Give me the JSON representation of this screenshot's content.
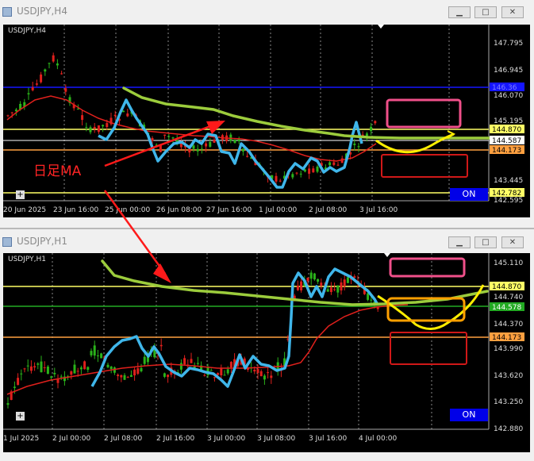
{
  "chart_data": [
    {
      "type": "candlestick",
      "window_title": "USDJPY,H4",
      "symbol_label": "USDJPY,H4",
      "y_ticks": [
        "147.795",
        "146.945",
        "146.070",
        "145.195",
        "144.870",
        "144.587",
        "144.173",
        "143.445",
        "142.782",
        "142.595"
      ],
      "x_ticks": [
        "20 Jun 2025",
        "23 Jun 16:00",
        "25 Jun 00:00",
        "26 Jun 08:00",
        "27 Jun 16:00",
        "1 Jul 00:00",
        "2 Jul 08:00",
        "3 Jul 16:00"
      ],
      "hidden_label": "146.36",
      "price_lines": [
        {
          "value": 146.36,
          "color": "#1515ff"
        },
        {
          "value": 144.87,
          "color": "#ffff66"
        },
        {
          "value": 144.587,
          "color": "#ffffff"
        },
        {
          "value": 144.173,
          "color": "#ffa040"
        },
        {
          "value": 142.782,
          "color": "#ffff66"
        }
      ],
      "annotation_text": "日足MA",
      "on_label": "ON"
    },
    {
      "type": "candlestick",
      "window_title": "USDJPY,H1",
      "symbol_label": "USDJPY,H1",
      "y_ticks": [
        "145.110",
        "144.870",
        "144.740",
        "144.578",
        "144.370",
        "144.173",
        "143.990",
        "143.620",
        "143.250",
        "142.880"
      ],
      "x_ticks": [
        "1 Jul 2025",
        "2 Jul 00:00",
        "2 Jul 08:00",
        "2 Jul 16:00",
        "3 Jul 00:00",
        "3 Jul 08:00",
        "3 Jul 16:00",
        "4 Jul 00:00"
      ],
      "price_lines": [
        {
          "value": 144.87,
          "color": "#ffff66"
        },
        {
          "value": 144.578,
          "color": "#22aa22"
        },
        {
          "value": 144.173,
          "color": "#ffa040"
        }
      ],
      "on_label": "ON"
    }
  ],
  "colors": {
    "candle_up": "#2ab31a",
    "candle_down": "#e0201c",
    "ma": "#e0201c",
    "blue_trace": "#3fb6ea",
    "green_ma": "#9ccc3c",
    "yellow_curve": "#ffee00"
  },
  "icons": [
    "window-icon",
    "minimize-icon",
    "restore-icon",
    "close-icon"
  ]
}
